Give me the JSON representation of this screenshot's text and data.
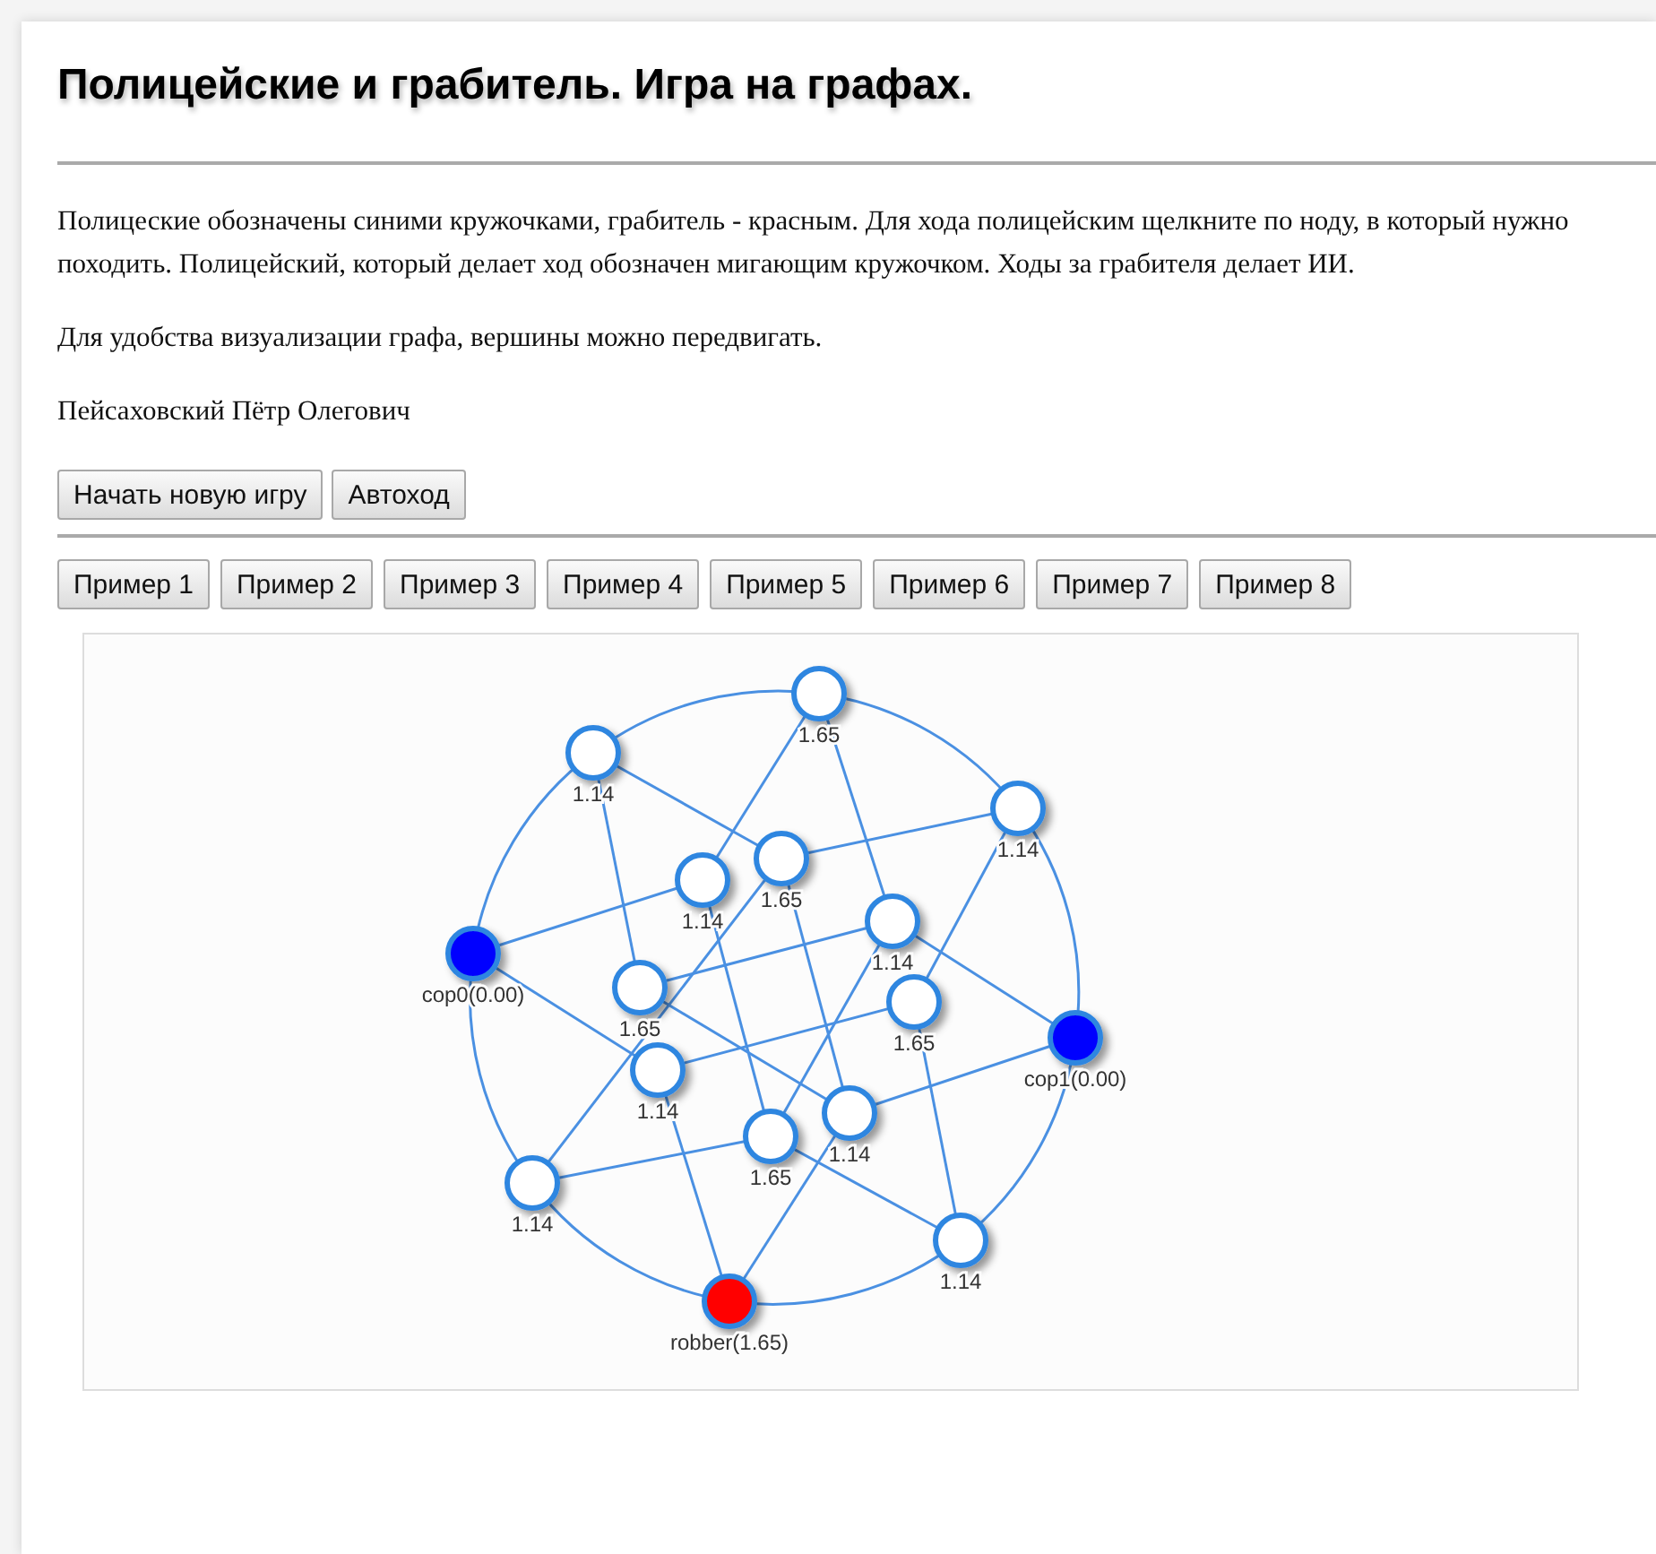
{
  "title": "Полицейские и грабитель. Игра на графах.",
  "paragraphs": [
    "Полицеские обозначены синими кружочками, грабитель - красным. Для хода полицейским щелкните по ноду, в который нужно походить. Полицейский, который делает ход обозначен мигающим кружочком. Ходы за грабителя делает ИИ.",
    "Для удобства визуализации графа, вершины можно передвигать.",
    "Пейсаховский Пётр Олегович"
  ],
  "controls": [
    "Начать новую игру",
    "Автоход"
  ],
  "examples": [
    "Пример 1",
    "Пример 2",
    "Пример 3",
    "Пример 4",
    "Пример 5",
    "Пример 6",
    "Пример 7",
    "Пример 8"
  ],
  "graph": {
    "nodes": [
      {
        "kind": "plain",
        "label": "1.65"
      },
      {
        "kind": "plain",
        "label": "1.14"
      },
      {
        "kind": "plain",
        "label": "1.14"
      },
      {
        "kind": "plain",
        "label": "1.14"
      },
      {
        "kind": "plain",
        "label": "1.65"
      },
      {
        "kind": "cop",
        "label": "cop0(0.00)"
      },
      {
        "kind": "plain",
        "label": "1.14"
      },
      {
        "kind": "plain",
        "label": "1.65"
      },
      {
        "kind": "plain",
        "label": "1.65"
      },
      {
        "kind": "cop",
        "label": "cop1(0.00)"
      },
      {
        "kind": "plain",
        "label": "1.14"
      },
      {
        "kind": "plain",
        "label": "1.14"
      },
      {
        "kind": "plain",
        "label": "1.65"
      },
      {
        "kind": "plain",
        "label": "1.14"
      },
      {
        "kind": "plain",
        "label": "1.14"
      },
      {
        "kind": "robber",
        "label": "robber(1.65)"
      }
    ]
  }
}
